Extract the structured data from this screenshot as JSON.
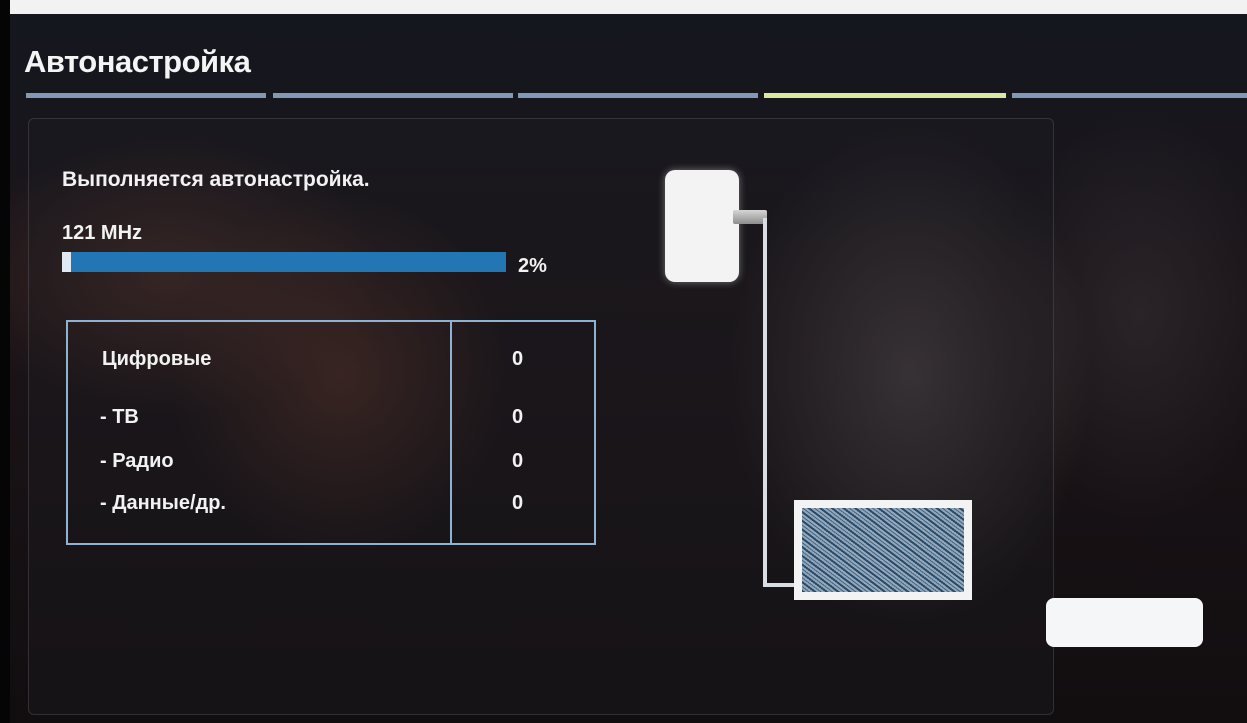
{
  "header": {
    "title": "Автонастройка",
    "steps": [
      {
        "state": "done"
      },
      {
        "state": "done"
      },
      {
        "state": "done"
      },
      {
        "state": "active"
      },
      {
        "state": "pending"
      }
    ]
  },
  "scan": {
    "status_text": "Выполняется автонастройка.",
    "frequency": "121 MHz",
    "progress_percent": 2,
    "progress_label": "2%"
  },
  "results": {
    "rows": [
      {
        "label": "Цифровые",
        "value": "0"
      },
      {
        "label": "- ТВ",
        "value": "0"
      },
      {
        "label": "- Радио",
        "value": "0"
      },
      {
        "label": "- Данные/др.",
        "value": "0"
      }
    ]
  },
  "illustration": {
    "icons": [
      "antenna-socket-icon",
      "cable-icon",
      "tv-static-icon"
    ]
  },
  "colors": {
    "progress_track": "#2276b3",
    "step_active": "#d8eaa0",
    "step_inactive": "#7f99b6",
    "table_border": "#8fb2d0"
  },
  "button": {
    "label": ""
  }
}
